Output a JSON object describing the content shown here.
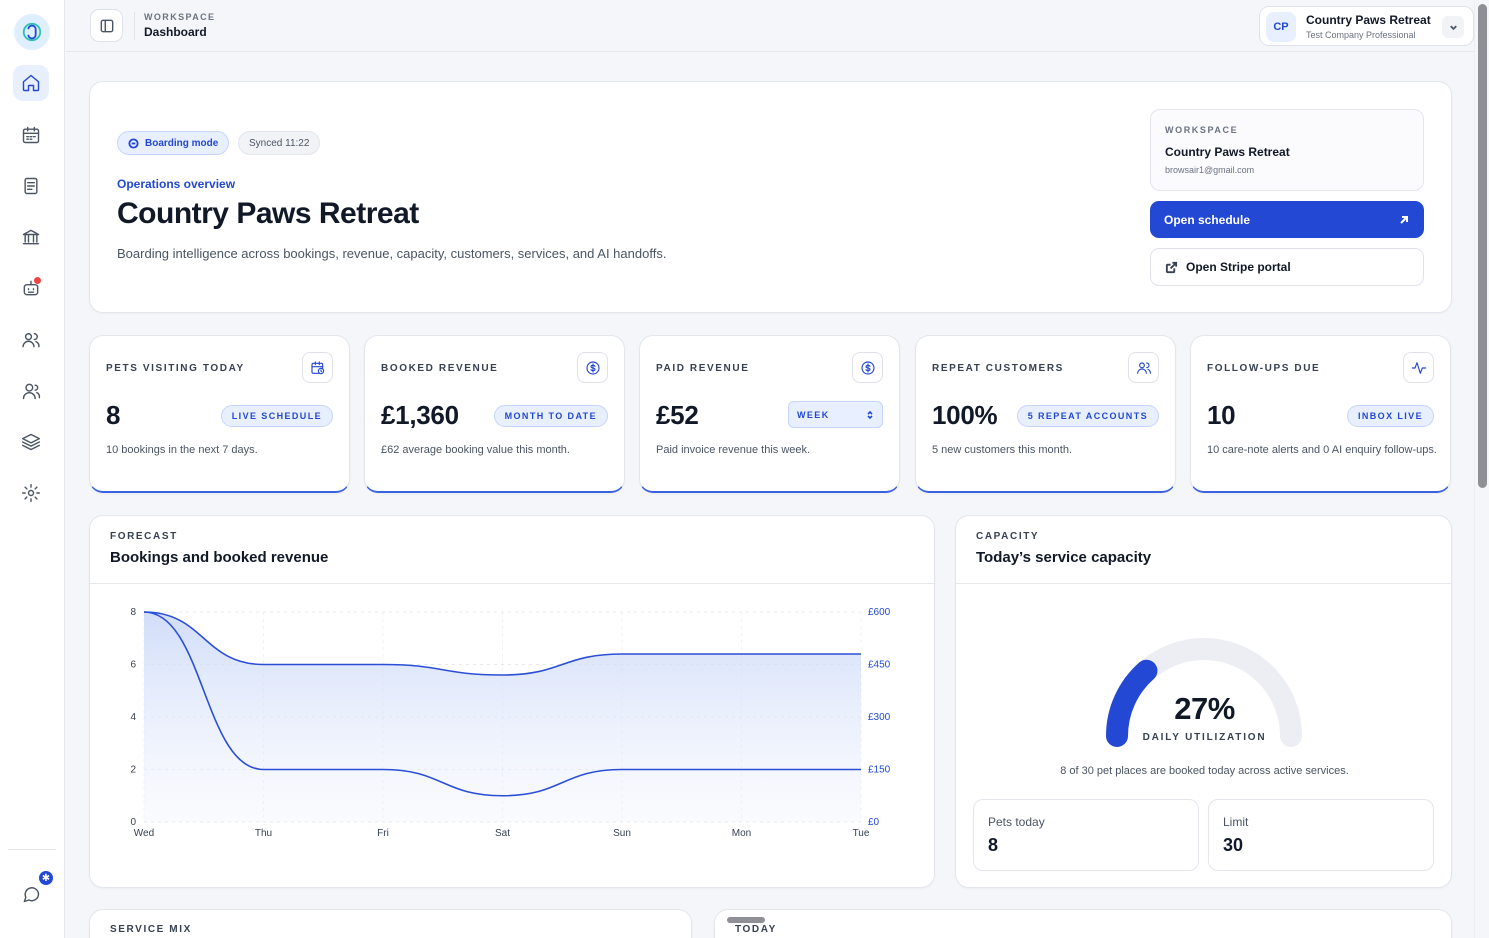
{
  "topbar": {
    "eyebrow": "WORKSPACE",
    "title": "Dashboard",
    "account": {
      "initials": "CP",
      "name": "Country Paws Retreat",
      "plan": "Test Company Professional"
    }
  },
  "hero": {
    "mode_pill": "Boarding mode",
    "sync_pill": "Synced 11:22",
    "eyebrow": "Operations overview",
    "title": "Country Paws Retreat",
    "description": "Boarding intelligence across bookings, revenue, capacity, customers, services, and AI handoffs.",
    "workspace": {
      "label": "WORKSPACE",
      "name": "Country Paws Retreat",
      "email": "browsair1@gmail.com"
    },
    "primary_button": "Open schedule",
    "secondary_button": "Open Stripe portal"
  },
  "stats": [
    {
      "label": "PETS VISITING TODAY",
      "value": "8",
      "tag": "LIVE SCHEDULE",
      "desc": "10 bookings in the next 7 days.",
      "icon": "calendar-clock-icon"
    },
    {
      "label": "BOOKED REVENUE",
      "value": "£1,360",
      "tag": "MONTH TO DATE",
      "desc": "£62 average booking value this month.",
      "icon": "dollar-circle-icon"
    },
    {
      "label": "PAID REVENUE",
      "value": "£52",
      "select": "WEEK",
      "desc": "Paid invoice revenue this week.",
      "icon": "dollar-circle-icon"
    },
    {
      "label": "REPEAT CUSTOMERS",
      "value": "100%",
      "tag": "5 REPEAT ACCOUNTS",
      "desc": "5 new customers this month.",
      "icon": "users-icon"
    },
    {
      "label": "FOLLOW-UPS DUE",
      "value": "10",
      "tag": "INBOX LIVE",
      "desc": "10 care-note alerts and 0 AI enquiry follow-ups.",
      "icon": "activity-icon"
    }
  ],
  "forecast": {
    "eyebrow": "FORECAST",
    "title": "Bookings and booked revenue"
  },
  "chart_data": {
    "type": "area",
    "categories": [
      "Wed",
      "Thu",
      "Fri",
      "Sat",
      "Sun",
      "Mon",
      "Tue"
    ],
    "series": [
      {
        "axis": "left",
        "values": [
          8,
          2,
          2,
          1,
          2,
          2,
          2
        ]
      },
      {
        "axis": "right",
        "values": [
          600,
          450,
          450,
          420,
          480,
          480,
          480
        ]
      }
    ],
    "y_left": {
      "min": 0,
      "max": 8,
      "ticks": [
        "0",
        "2",
        "4",
        "6",
        "8"
      ]
    },
    "y_right": {
      "min": 0,
      "max": 600,
      "ticks": [
        "£0",
        "£150",
        "£300",
        "£450",
        "£600"
      ]
    },
    "colors": {
      "line": "#2b4fd6",
      "fill": "#dbe5fb"
    },
    "grid": true
  },
  "capacity": {
    "eyebrow": "CAPACITY",
    "title": "Today’s service capacity",
    "utilization": 0.27,
    "value": "27%",
    "label": "DAILY UTILIZATION",
    "desc": "8 of 30 pet places are booked today across active services.",
    "pets_label": "Pets today",
    "pets_value": "8",
    "limit_label": "Limit",
    "limit_value": "30"
  },
  "bottom": {
    "service_mix": "SERVICE MIX",
    "today": "TODAY"
  },
  "colors": {
    "accent": "#2348d4",
    "accent_soft": "#e8efff"
  }
}
